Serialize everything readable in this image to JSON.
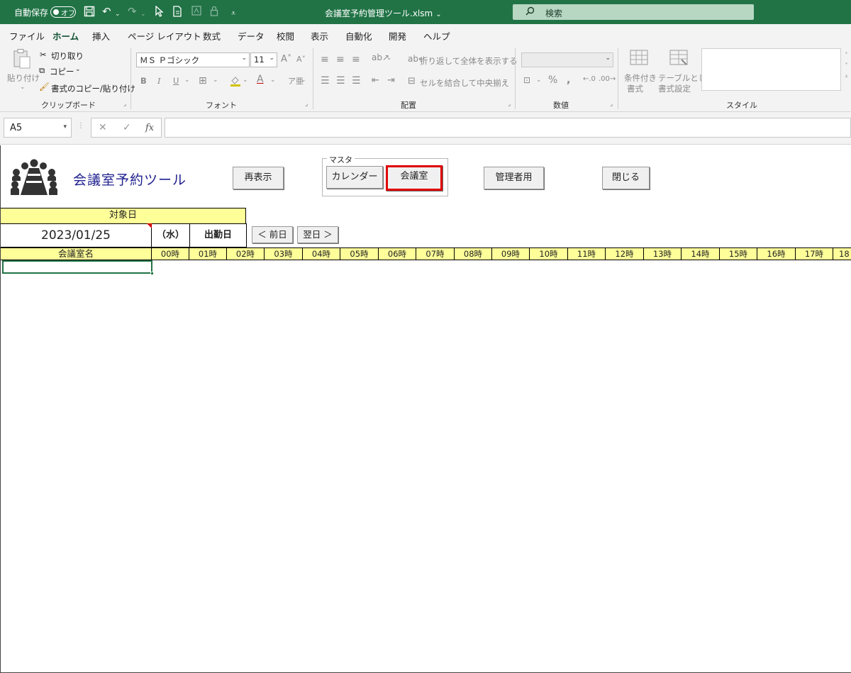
{
  "titlebar": {
    "autosave_label": "自動保存",
    "autosave_state": "オフ",
    "doc_title": "会議室予約管理ツール.xlsm",
    "search_placeholder": "検索",
    "bg_color": "#217346"
  },
  "menu": {
    "items": [
      "ファイル",
      "ホーム",
      "挿入",
      "ページ レイアウト",
      "数式",
      "データ",
      "校閲",
      "表示",
      "自動化",
      "開発",
      "ヘルプ"
    ],
    "active": "ホーム"
  },
  "ribbon": {
    "clipboard": {
      "paste": "貼り付け",
      "cut": "切り取り",
      "copy": "コピー",
      "format_painter": "書式のコピー/貼り付け",
      "label": "クリップボード"
    },
    "font": {
      "font_name": "ＭＳ Ｐゴシック",
      "font_size": "11",
      "bold": "B",
      "italic": "I",
      "underline": "U",
      "label": "フォント"
    },
    "alignment": {
      "wrap_text": "折り返して全体を表示する",
      "merge_center": "セルを結合して中央揃え",
      "label": "配置"
    },
    "number": {
      "label": "数値"
    },
    "styles": {
      "conditional": "条件付き",
      "conditional2": "書式",
      "table": "テーブルとして",
      "table2": "書式設定",
      "label": "スタイル"
    }
  },
  "formula_bar": {
    "name_box": "A5",
    "fx": "fx",
    "formula": ""
  },
  "sheet": {
    "app_title": "会議室予約ツール",
    "buttons": {
      "refresh": "再表示",
      "master_legend": "マスタ",
      "calendar": "カレンダー",
      "rooms": "会議室",
      "admin": "管理者用",
      "close": "閉じる"
    },
    "target_date_label": "対象日",
    "date_value": "2023/01/25",
    "weekday": "（水）",
    "workday": "出勤日",
    "prev_day": "＜ 前日",
    "next_day": "翌日 ＞",
    "room_name_header": "会議室名",
    "hours": [
      "00時",
      "01時",
      "02時",
      "03時",
      "04時",
      "05時",
      "06時",
      "07時",
      "08時",
      "09時",
      "10時",
      "11時",
      "12時",
      "13時",
      "14時",
      "15時",
      "16時",
      "17時",
      "18"
    ],
    "header_color": "#ffff99",
    "selection_color": "#217346",
    "highlight_color": "#e00000"
  }
}
